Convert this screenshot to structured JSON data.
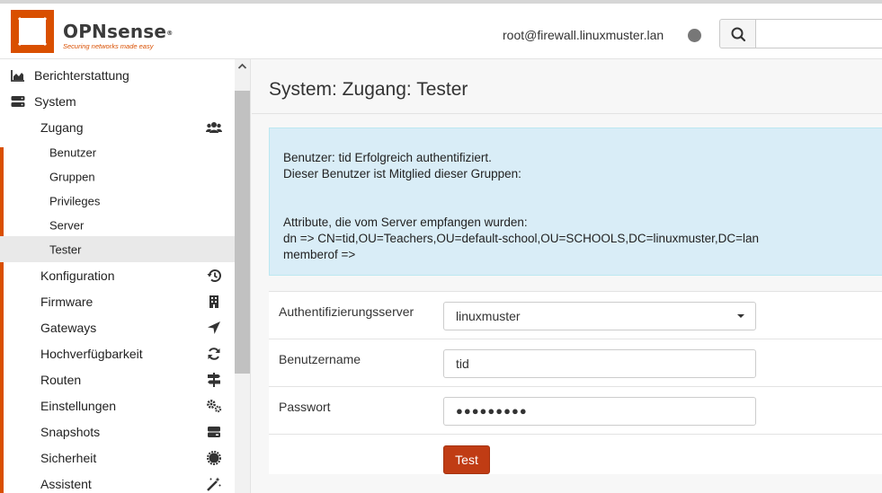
{
  "header": {
    "brand_name": "OPNsense",
    "brand_reg": "®",
    "brand_tagline": "Securing networks made easy",
    "user": "root@firewall.linuxmuster.lan",
    "search_placeholder": "",
    "accent_color": "#d94f00"
  },
  "sidebar": {
    "items": [
      {
        "label": "Berichterstattung",
        "level": 0,
        "icon": "area-chart-icon"
      },
      {
        "label": "System",
        "level": 0,
        "icon": "server-icon"
      },
      {
        "label": "Zugang",
        "level": 1,
        "icon": "users-icon"
      },
      {
        "label": "Benutzer",
        "level": 2
      },
      {
        "label": "Gruppen",
        "level": 2
      },
      {
        "label": "Privileges",
        "level": 2
      },
      {
        "label": "Server",
        "level": 2
      },
      {
        "label": "Tester",
        "level": 2,
        "selected": true
      },
      {
        "label": "Konfiguration",
        "level": 1,
        "icon": "history-icon"
      },
      {
        "label": "Firmware",
        "level": 1,
        "icon": "building-icon"
      },
      {
        "label": "Gateways",
        "level": 1,
        "icon": "location-arrow-icon"
      },
      {
        "label": "Hochverfügbarkeit",
        "level": 1,
        "icon": "refresh-icon"
      },
      {
        "label": "Routen",
        "level": 1,
        "icon": "signpost-icon"
      },
      {
        "label": "Einstellungen",
        "level": 1,
        "icon": "cogs-icon"
      },
      {
        "label": "Snapshots",
        "level": 1,
        "icon": "hdd-icon"
      },
      {
        "label": "Sicherheit",
        "level": 1,
        "icon": "certificate-icon"
      },
      {
        "label": "Assistent",
        "level": 1,
        "icon": "magic-wand-icon"
      }
    ]
  },
  "main": {
    "title": "System: Zugang: Tester",
    "alert": {
      "line1": "Benutzer: tid Erfolgreich authentifiziert.",
      "line2": "Dieser Benutzer ist Mitglied dieser Gruppen:",
      "line3": "Attribute, die vom Server empfangen wurden:",
      "line4": "dn => CN=tid,OU=Teachers,OU=default-school,OU=SCHOOLS,DC=linuxmuster,DC=lan",
      "line5": "memberof =>"
    },
    "form": {
      "server_label": "Authentifizierungsserver",
      "server_value": "linuxmuster",
      "username_label": "Benutzername",
      "username_value": "tid",
      "password_label": "Passwort",
      "password_value": "●●●●●●●●●",
      "test_button": "Test"
    }
  }
}
